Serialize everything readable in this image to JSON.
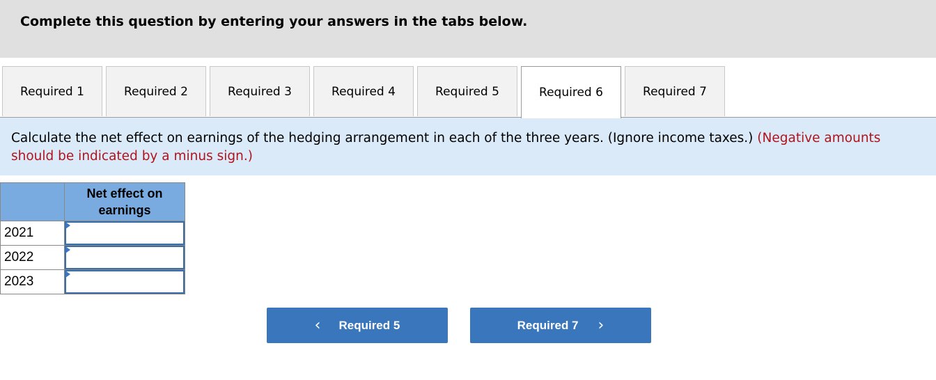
{
  "header": {
    "instruction": "Complete this question by entering your answers in the tabs below."
  },
  "tabs": [
    {
      "label": "Required 1",
      "active": false
    },
    {
      "label": "Required 2",
      "active": false
    },
    {
      "label": "Required 3",
      "active": false
    },
    {
      "label": "Required 4",
      "active": false
    },
    {
      "label": "Required 5",
      "active": false
    },
    {
      "label": "Required 6",
      "active": true
    },
    {
      "label": "Required 7",
      "active": false
    }
  ],
  "question": {
    "text": "Calculate the net effect on earnings of the hedging arrangement in each of the three years. (Ignore income taxes.)",
    "note": "(Negative amounts should be indicated by a minus sign.)"
  },
  "table": {
    "column_header": "Net effect on earnings",
    "rows": [
      {
        "year": "2021",
        "value": ""
      },
      {
        "year": "2022",
        "value": ""
      },
      {
        "year": "2023",
        "value": ""
      }
    ]
  },
  "navigation": {
    "prev_label": "Required 5",
    "next_label": "Required 7",
    "prev_icon": "chevron-left-icon",
    "next_icon": "chevron-right-icon"
  },
  "colors": {
    "header_bg": "#e0e0e0",
    "instructions_bg": "#daeaf8",
    "note_red": "#b0141c",
    "table_header_bg": "#7aabe0",
    "button_blue": "#3a76bc"
  }
}
